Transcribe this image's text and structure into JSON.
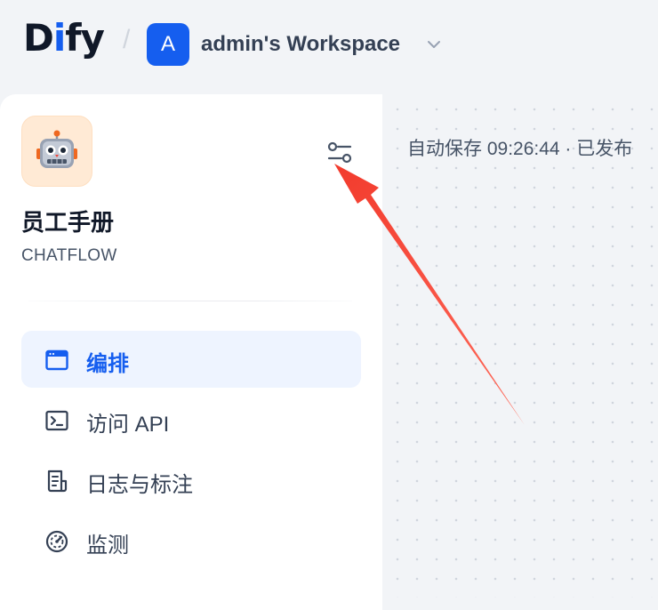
{
  "header": {
    "logo": {
      "part1": "D",
      "accent": "i",
      "part2": "fy"
    },
    "separator": "/",
    "workspace": {
      "initial": "A",
      "name": "admin's Workspace"
    }
  },
  "app": {
    "name": "员工手册",
    "mode": "CHATFLOW",
    "icon": "robot-emoji"
  },
  "nav": {
    "items": [
      {
        "label": "编排",
        "icon": "window-icon",
        "active": true
      },
      {
        "label": "访问 API",
        "icon": "terminal-icon",
        "active": false
      },
      {
        "label": "日志与标注",
        "icon": "file-list-icon",
        "active": false
      },
      {
        "label": "监测",
        "icon": "dashboard-icon",
        "active": false
      }
    ]
  },
  "canvas": {
    "autosave_text": "自动保存 09:26:44 · 已发布"
  },
  "colors": {
    "accent": "#155eef",
    "annotation_arrow": "#f04438",
    "active_nav_bg": "#eef4ff",
    "app_icon_bg": "#ffead5"
  }
}
